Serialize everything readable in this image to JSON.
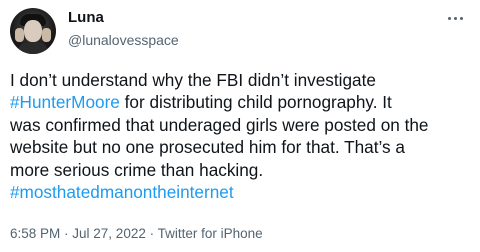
{
  "user": {
    "display_name": "Luna",
    "handle": "@lunalovesspace",
    "avatar_icon": "profile-photo"
  },
  "tweet": {
    "line1": "I don’t understand why the FBI didn’t investigate",
    "hashtag1": "#HunterMoore",
    "line2_rest": " for distributing child pornography. It",
    "line3": "was confirmed that underaged girls were posted on the",
    "line4": "website but no one prosecuted him for that. That’s a",
    "line5": "more serious crime than hacking.",
    "hashtag2": "#mosthatedmanontheinternet"
  },
  "meta": {
    "time": "6:58 PM",
    "sep1": " · ",
    "date": "Jul 27, 2022",
    "sep2": " · ",
    "source": "Twitter for iPhone"
  },
  "colors": {
    "hashtag": "#1d9bf0",
    "text": "#0f1419",
    "secondary": "#536471"
  }
}
